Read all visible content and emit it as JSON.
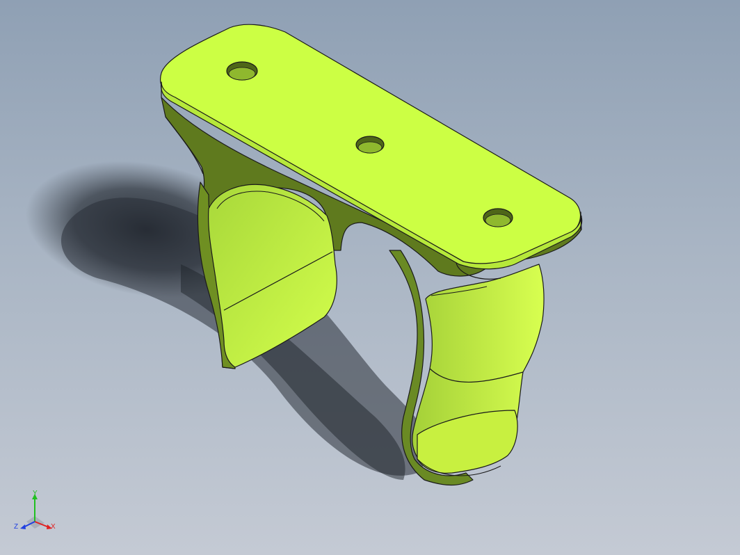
{
  "viewport": {
    "background_top": "#8fa0b4",
    "background_bottom": "#c4cad4"
  },
  "part": {
    "color": "#ccff44",
    "shade_color": "#5f7a1e",
    "edge_color": "#1a1a1a",
    "mounting_holes": 3
  },
  "triad": {
    "x_label": "X",
    "y_label": "Y",
    "z_label": "Z",
    "x_color": "#e02020",
    "y_color": "#20c020",
    "z_color": "#2040e0"
  }
}
